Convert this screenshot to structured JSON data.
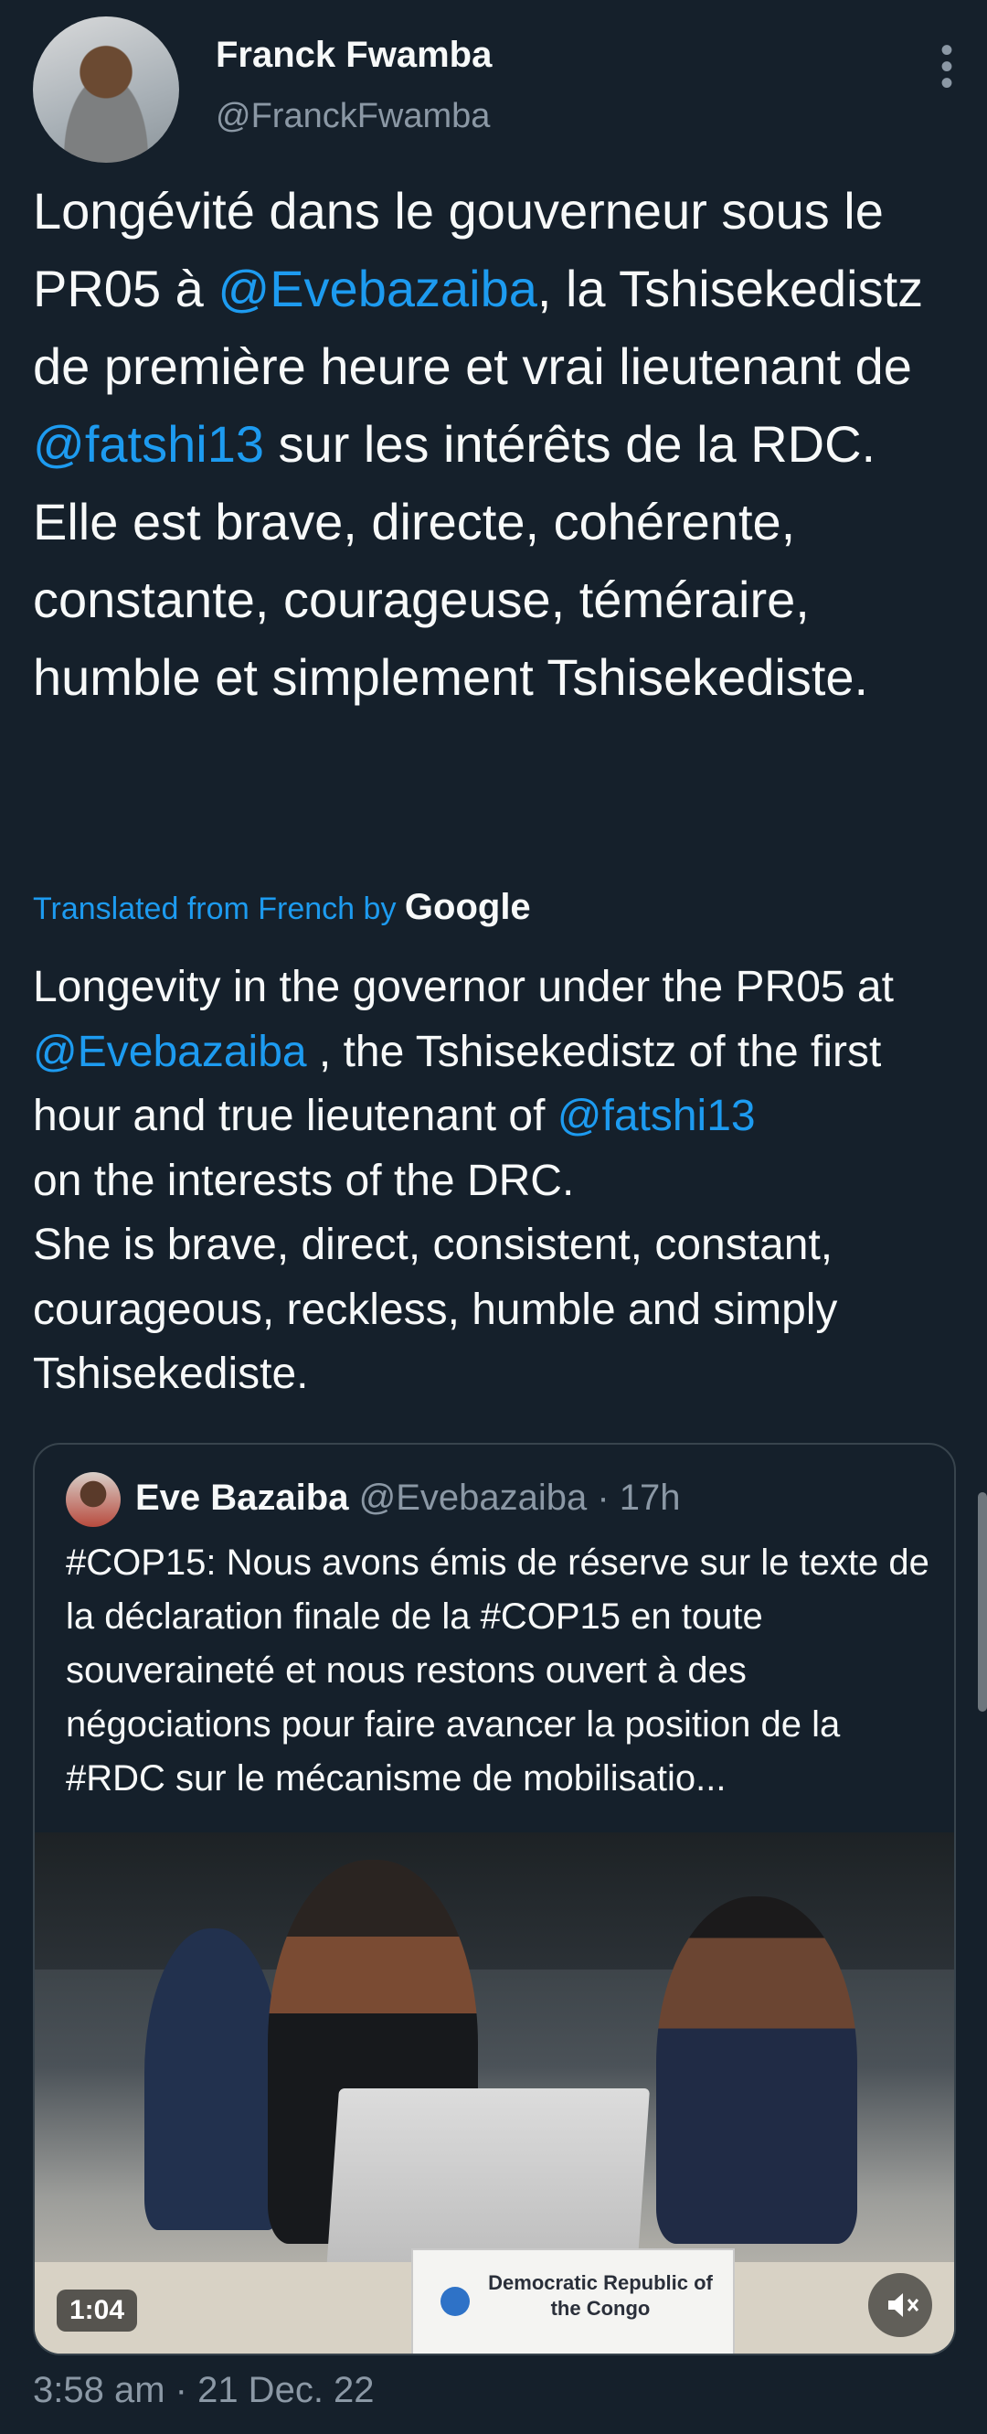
{
  "author": {
    "name": "Franck Fwamba",
    "handle": "@FranckFwamba"
  },
  "tweet": {
    "text_parts": [
      {
        "t": "Longévité dans le gouverneur sous le PR05 à "
      },
      {
        "t": "@Evebazaiba",
        "mention": true
      },
      {
        "t": ", la Tshisekedistz de première heure et vrai lieutenant de "
      },
      {
        "t": "@fatshi13",
        "mention": true
      },
      {
        "t": " sur les intérêts de la RDC.\nElle est brave, directe, cohérente, constante, courageuse, téméraire, humble et simplement Tshisekediste."
      }
    ],
    "translated_label": "Translated from French by",
    "google_label": "Google",
    "translation_parts": [
      {
        "t": "Longevity in the governor under the PR05 at "
      },
      {
        "t": "@Evebazaiba",
        "mention": true
      },
      {
        "t": " , the Tshisekedistz of the first hour and true lieutenant of "
      },
      {
        "t": "@fatshi13",
        "mention": true
      },
      {
        "t": "\non the interests of the DRC.\nShe is brave, direct, consistent, constant, courageous, reckless, humble and simply Tshisekediste."
      }
    ],
    "timestamp": "3:58 am · 21 Dec. 22"
  },
  "quote": {
    "name": "Eve Bazaiba",
    "handle": "@Evebazaiba",
    "time": "· 17h",
    "text": "#COP15: Nous avons émis de réserve sur le texte de la déclaration finale de la #COP15 en toute souveraineté et nous restons ouvert à des négociations pour faire avancer la position de la #RDC sur le mécanisme de mobilisatio...",
    "video_duration": "1:04",
    "placard_text": "Democratic Republic of the Congo"
  },
  "icons": {
    "more": "more-vertical-icon",
    "mute": "volume-mute-icon"
  },
  "colors": {
    "background": "#15202b",
    "text": "#f7f9f9",
    "secondary": "#8b98a5",
    "accent": "#1d9bf0",
    "border": "#38444d"
  }
}
